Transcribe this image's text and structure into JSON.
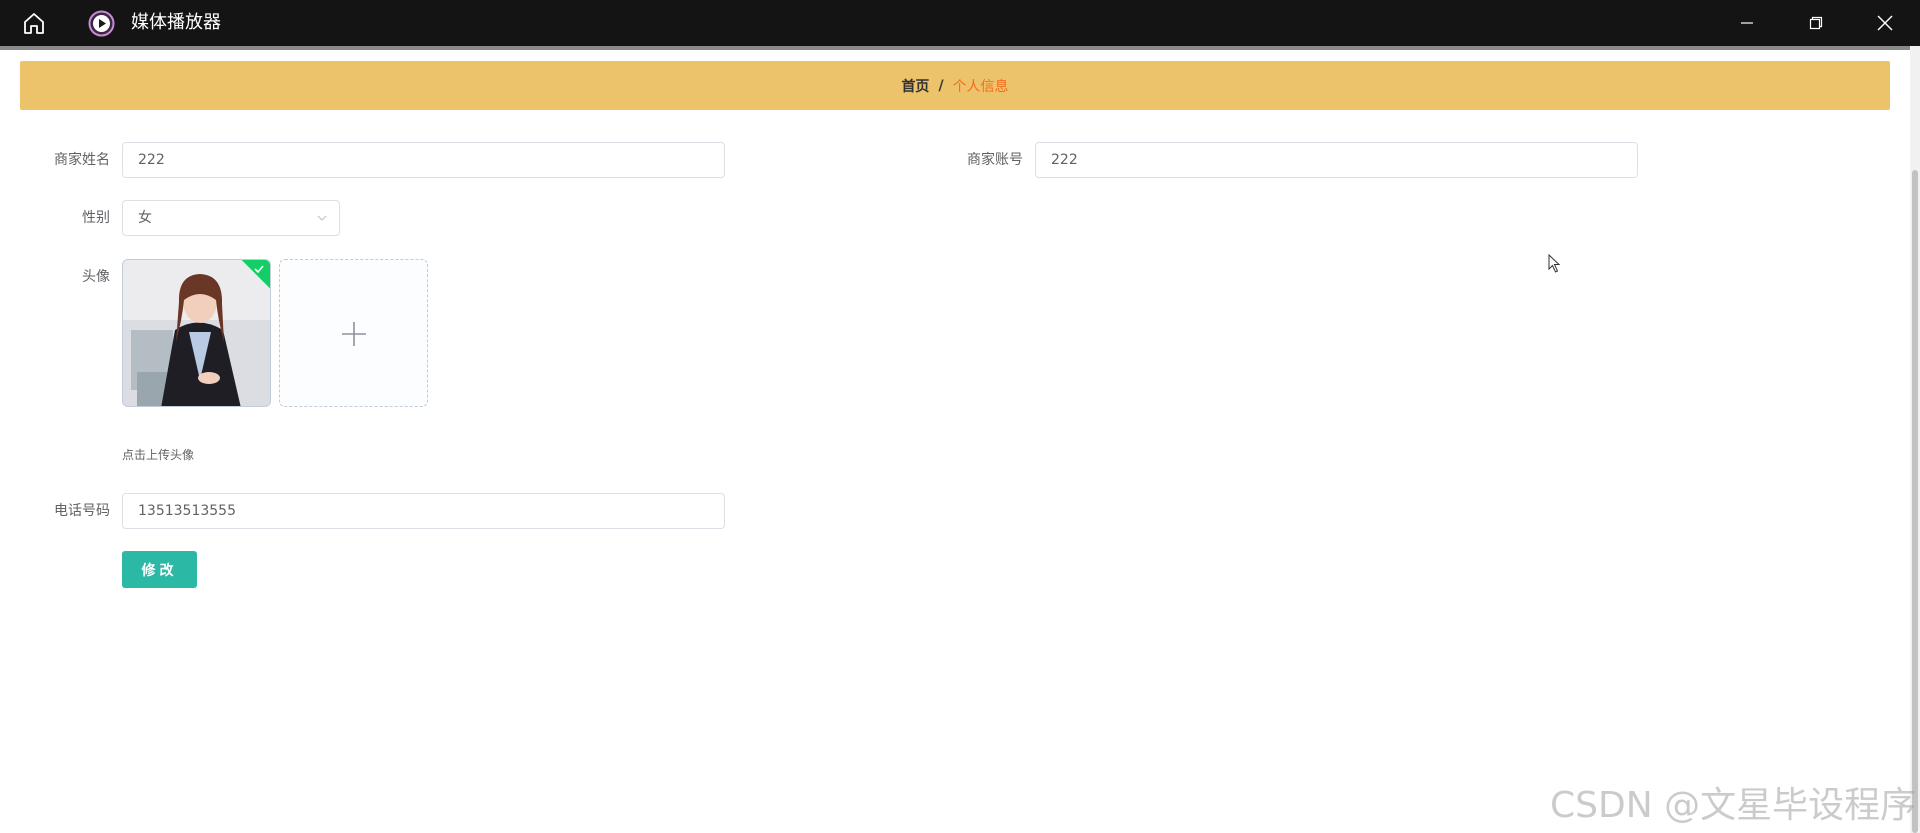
{
  "window": {
    "title": "媒体播放器",
    "home_icon": "home-icon",
    "logo_icon": "media-player-logo-icon",
    "controls": [
      "minimize-icon",
      "maximize-icon",
      "close-icon"
    ]
  },
  "breadcrumb": {
    "home": "首页",
    "separator": "/",
    "current": "个人信息"
  },
  "form": {
    "merchant_name": {
      "label": "商家姓名",
      "value": "222"
    },
    "merchant_account": {
      "label": "商家账号",
      "value": "222"
    },
    "gender": {
      "label": "性别",
      "value": "女"
    },
    "avatar": {
      "label": "头像",
      "tip": "点击上传头像"
    },
    "phone": {
      "label": "电话号码",
      "value": "13513513555"
    },
    "submit_label": "修改"
  },
  "watermark": "CSDN @文星毕设程序",
  "colors": {
    "breadcrumb_bg": "#ecc36b",
    "breadcrumb_current": "#f56c1c",
    "button": "#2bb8a4",
    "titlebar": "#141414"
  }
}
